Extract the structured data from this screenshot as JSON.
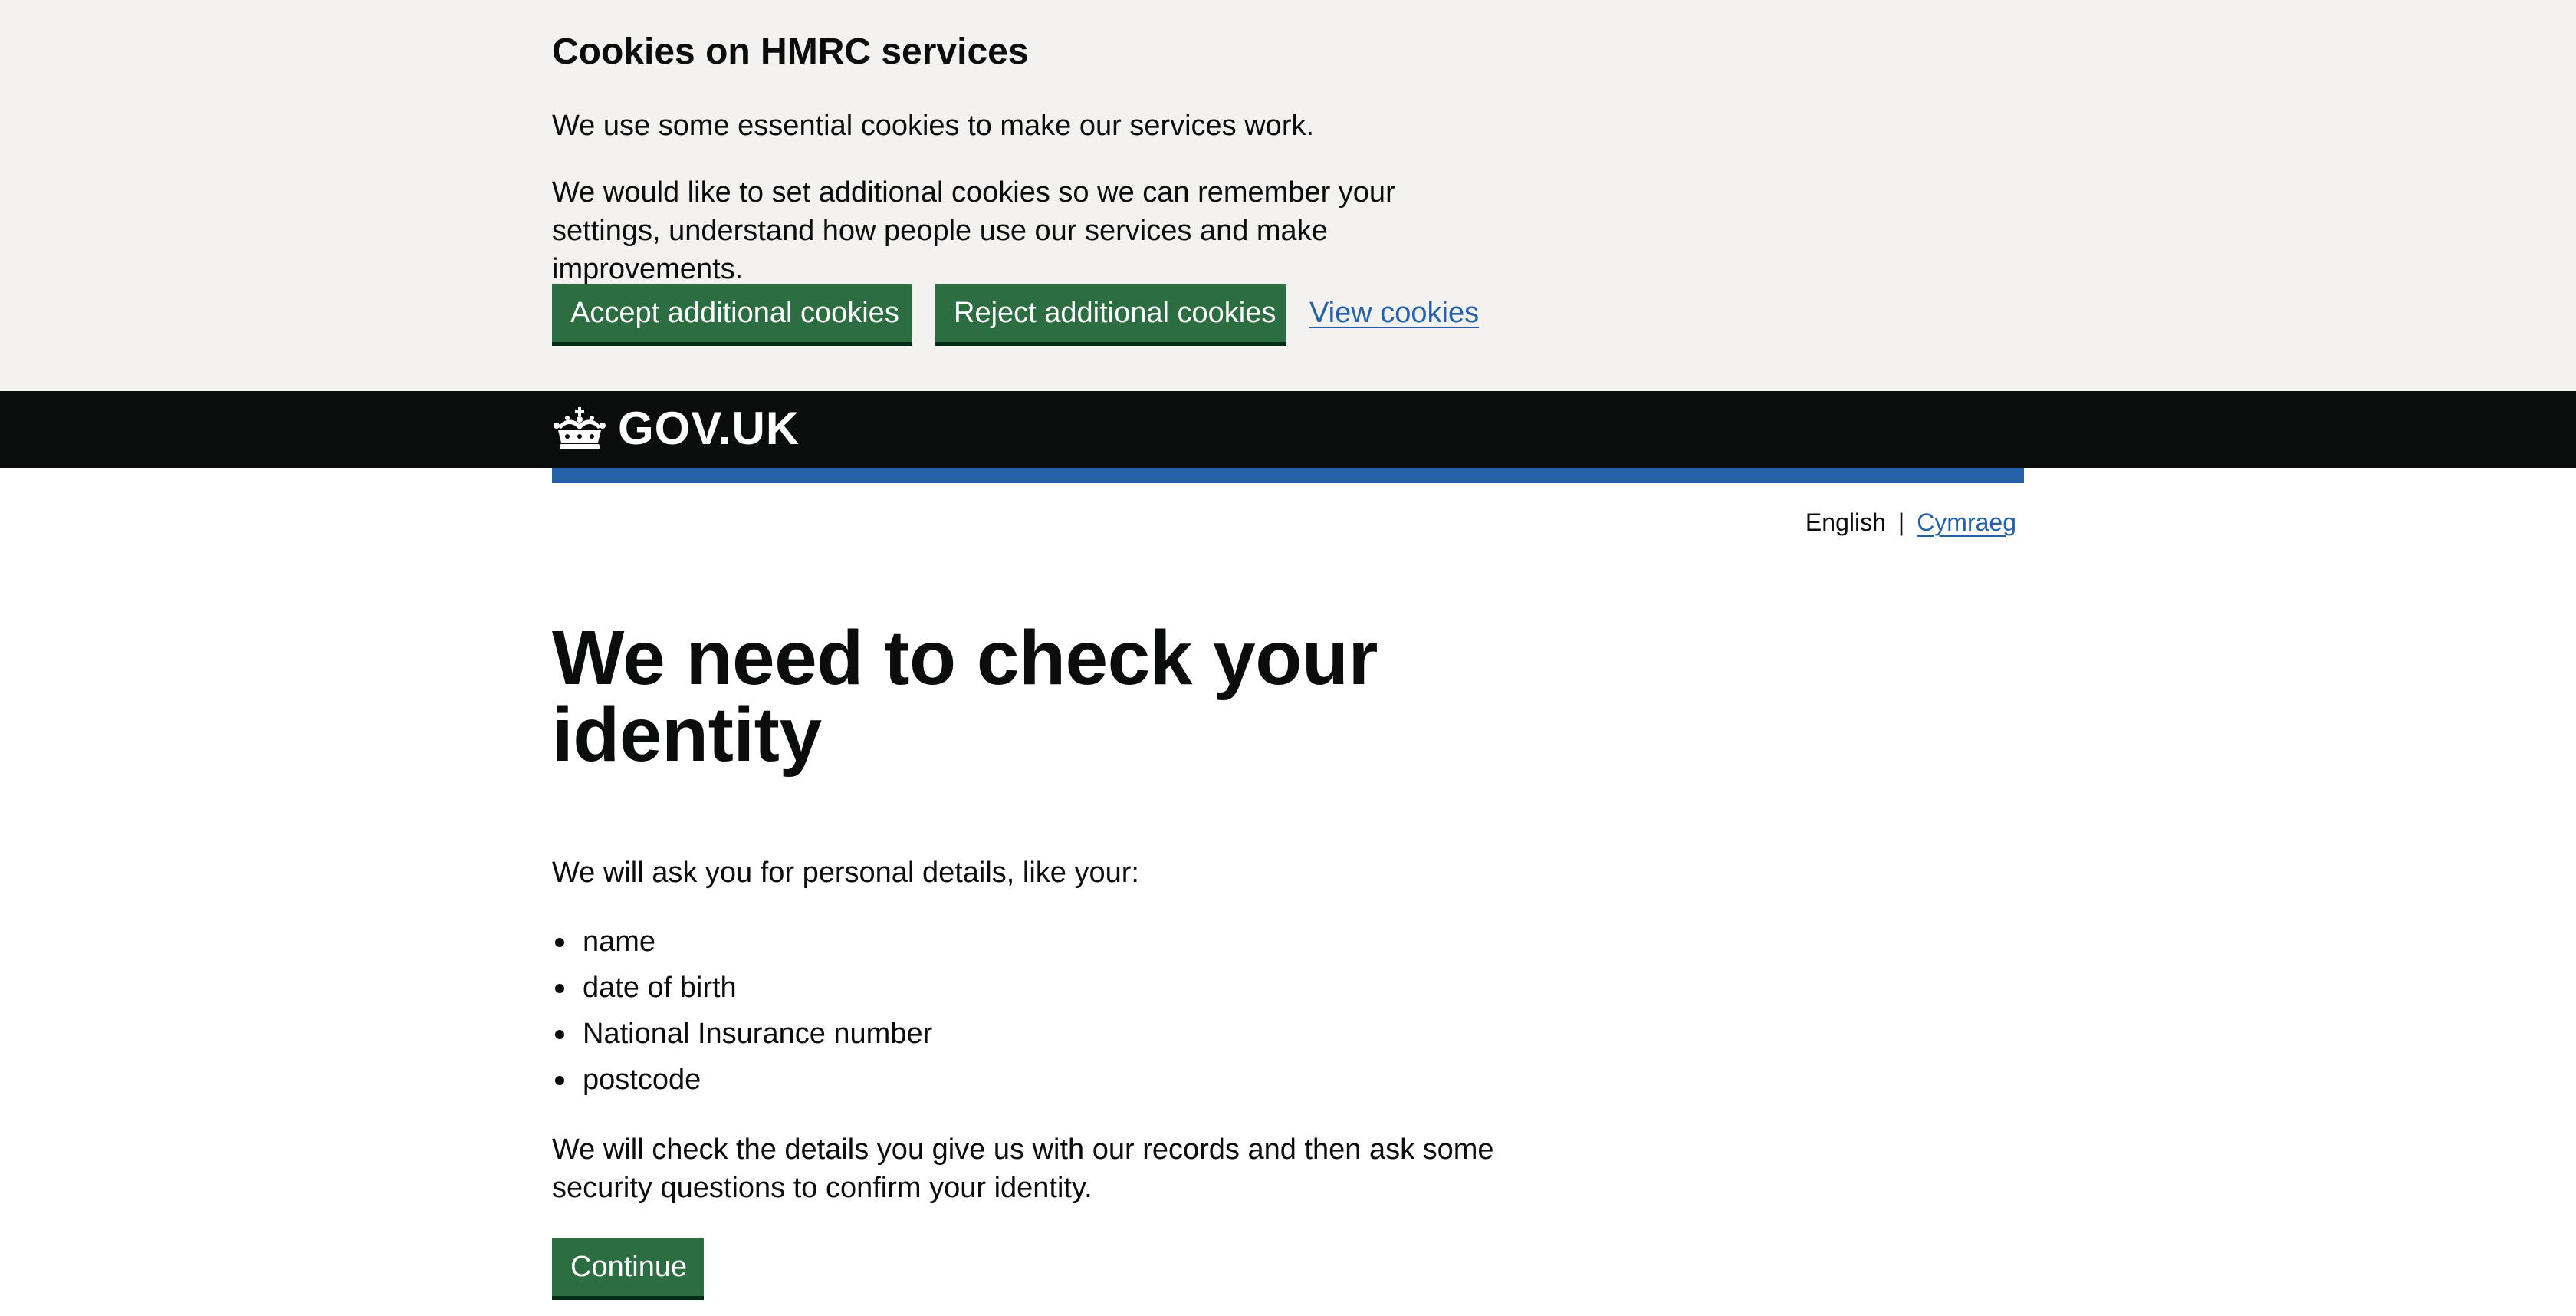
{
  "cookie_banner": {
    "title": "Cookies on HMRC services",
    "paragraph_1": "We use some essential cookies to make our services work.",
    "paragraph_2": "We would like to set additional cookies so we can remember your settings, understand how people use our services and make improvements.",
    "accept_label": "Accept additional cookies",
    "reject_label": "Reject additional cookies",
    "view_label": "View cookies"
  },
  "header": {
    "logo_text": "GOV.UK",
    "logo_icon": "crown-icon"
  },
  "language": {
    "current": "English",
    "separator": "|",
    "alternate": "Cymraeg"
  },
  "main": {
    "title": "We need to check your identity",
    "intro": "We will ask you for personal details, like your:",
    "details": [
      "name",
      "date of birth",
      "National Insurance number",
      "postcode"
    ],
    "outro": "We will check the details you give us with our records and then ask some security questions to confirm your identity.",
    "continue_label": "Continue"
  },
  "colors": {
    "banner_background": "#f3f2f1",
    "button_green": "#2c6e42",
    "header_black": "#0b0c0c",
    "brand_blue": "#2461a8",
    "link_blue": "#2461a8"
  }
}
